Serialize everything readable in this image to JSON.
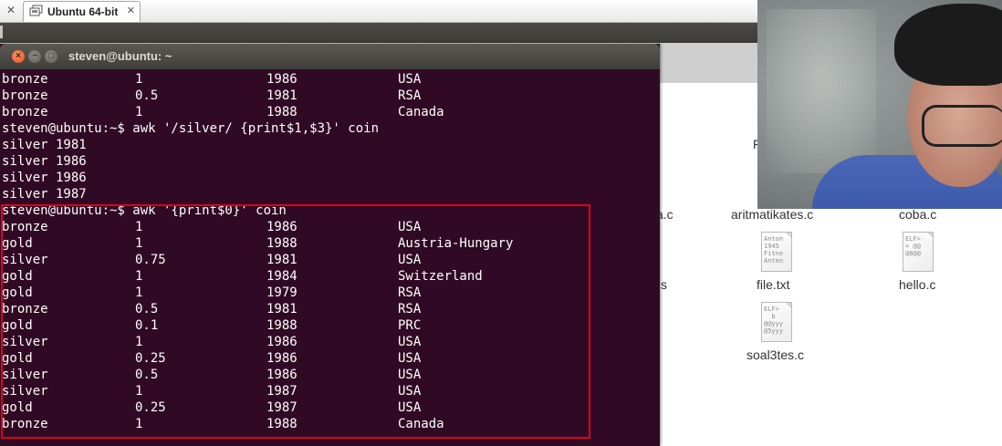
{
  "vmware": {
    "close_glyph": "✕",
    "tab_label": "Ubuntu 64-bit",
    "tab_close_glyph": "✕",
    "tab_icon": "vm-pages-icon"
  },
  "terminal": {
    "title": "steven@ubuntu: ~",
    "close_glyph": "×",
    "minimize_glyph": "−",
    "maximize_glyph": "□",
    "lines": [
      {
        "type": "row",
        "cells": [
          "bronze",
          "1",
          "1986",
          "USA"
        ]
      },
      {
        "type": "row",
        "cells": [
          "bronze",
          "0.5",
          "1981",
          "RSA"
        ]
      },
      {
        "type": "row",
        "cells": [
          "bronze",
          "1",
          "1988",
          "Canada"
        ]
      },
      {
        "type": "text",
        "text": "steven@ubuntu:~$ awk '/silver/ {print$1,$3}' coin"
      },
      {
        "type": "text",
        "text": "silver 1981"
      },
      {
        "type": "text",
        "text": "silver 1986"
      },
      {
        "type": "text",
        "text": "silver 1986"
      },
      {
        "type": "text",
        "text": "silver 1987"
      },
      {
        "type": "text",
        "text": "steven@ubuntu:~$ awk '{print$0}' coin"
      },
      {
        "type": "row",
        "cells": [
          "bronze",
          "1",
          "1986",
          "USA"
        ]
      },
      {
        "type": "row",
        "cells": [
          "gold",
          "1",
          "1988",
          "Austria-Hungary"
        ]
      },
      {
        "type": "row",
        "cells": [
          "silver",
          "0.75",
          "1981",
          "USA"
        ]
      },
      {
        "type": "row",
        "cells": [
          "gold",
          "1",
          "1984",
          "Switzerland"
        ]
      },
      {
        "type": "row",
        "cells": [
          "gold",
          "1",
          "1979",
          "RSA"
        ]
      },
      {
        "type": "row",
        "cells": [
          "bronze",
          "0.5",
          "1981",
          "RSA"
        ]
      },
      {
        "type": "row",
        "cells": [
          "gold",
          "0.1",
          "1988",
          "PRC"
        ]
      },
      {
        "type": "row",
        "cells": [
          "silver",
          "1",
          "1986",
          "USA"
        ]
      },
      {
        "type": "row",
        "cells": [
          "gold",
          "0.25",
          "1986",
          "USA"
        ]
      },
      {
        "type": "row",
        "cells": [
          "silver",
          "0.5",
          "1986",
          "USA"
        ]
      },
      {
        "type": "row",
        "cells": [
          "silver",
          "1",
          "1987",
          "USA"
        ]
      },
      {
        "type": "row",
        "cells": [
          "gold",
          "0.25",
          "1987",
          "USA"
        ]
      },
      {
        "type": "row",
        "cells": [
          "bronze",
          "1",
          "1988",
          "Canada"
        ]
      }
    ]
  },
  "desktop": {
    "partial_label_1": "F",
    "partial_label_2": "a.c",
    "partial_label_3": "s",
    "files": [
      {
        "label": "aritmatikates.c",
        "icon": "c-source-file-icon"
      },
      {
        "label": "coba.c",
        "icon": "c-source-file-icon"
      },
      {
        "label": "file.txt",
        "icon": "text-file-icon",
        "preview": "Anton\n1945\nFitne\nAnten"
      },
      {
        "label": "hello.c",
        "icon": "c-source-file-icon",
        "preview": "ELF>\n= @@\n@8@@"
      },
      {
        "label": "soal3tes.c",
        "icon": "c-source-file-icon",
        "preview": "ELF>\n  b\n@@yyy\n@5yyy"
      }
    ]
  },
  "colors": {
    "terminal_bg": "#300a24",
    "highlight_border": "#e3001b",
    "close_button": "#e0531d"
  }
}
